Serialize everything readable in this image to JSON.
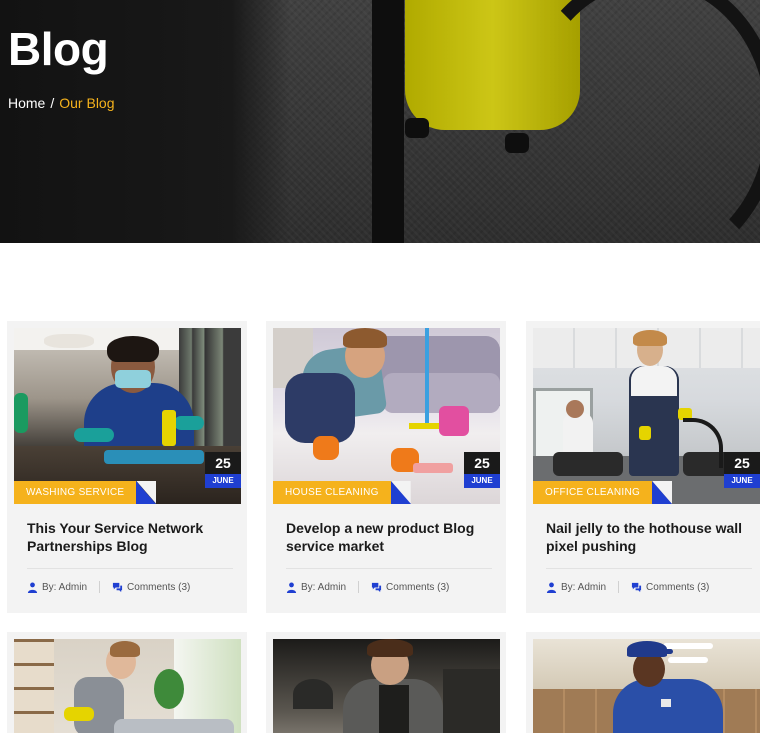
{
  "hero": {
    "title": "Blog",
    "breadcrumb": {
      "home": "Home",
      "separator": "/",
      "current": "Our Blog"
    }
  },
  "colors": {
    "accent": "#f5b21c",
    "blue": "#1f3fd1",
    "dark": "#1a1a1a"
  },
  "posts": [
    {
      "day": "25",
      "month": "JUNE",
      "category": "WASHING SERVICE",
      "title": "This Your Service Network Partnerships Blog",
      "author": "By: Admin",
      "comments": "Comments (3)",
      "image": "woman-cleaning-kitchen"
    },
    {
      "day": "25",
      "month": "JUNE",
      "category": "HOUSE CLEANING",
      "title": "Develop a new product Blog service market",
      "author": "By: Admin",
      "comments": "Comments (3)",
      "image": "man-scrubbing-floor"
    },
    {
      "day": "25",
      "month": "JUNE",
      "category": "OFFICE CLEANING",
      "title": "Nail jelly to the hothouse wall pixel pushing",
      "author": "By: Admin",
      "comments": "Comments (3)",
      "image": "office-vacuuming"
    },
    {
      "image": "woman-cleaning-living-room"
    },
    {
      "image": "man-cleaning-table"
    },
    {
      "image": "worker-in-cap"
    }
  ]
}
